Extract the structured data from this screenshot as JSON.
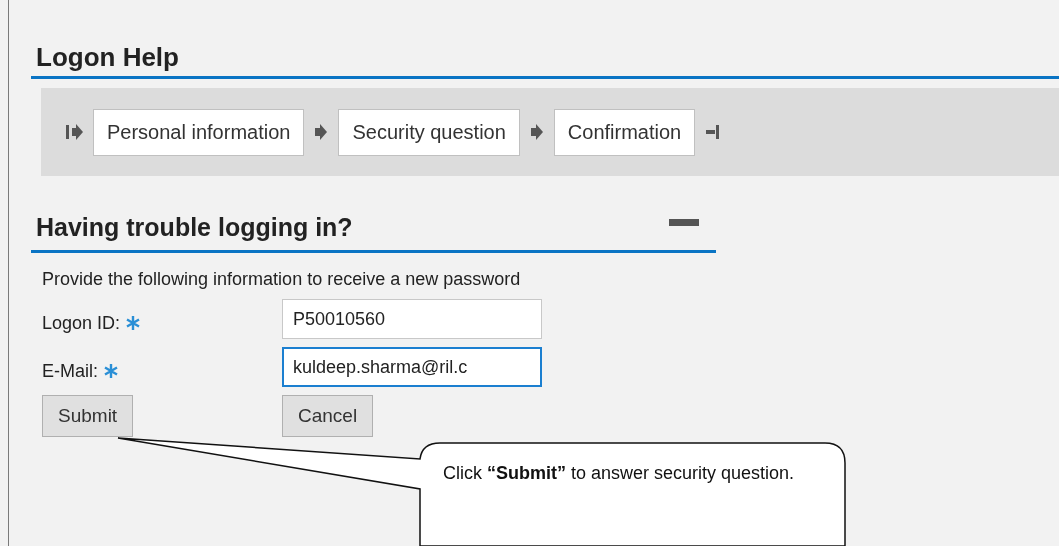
{
  "page_title": "Logon Help",
  "steps": [
    {
      "label": "Personal information"
    },
    {
      "label": "Security question"
    },
    {
      "label": "Confirmation"
    }
  ],
  "section": {
    "title": "Having trouble logging in?",
    "expanded": true,
    "instruction": "Provide the following information to receive a new password",
    "fields": [
      {
        "label": "Logon ID:",
        "required": true,
        "value": "P50010560",
        "focused": false
      },
      {
        "label": "E-Mail:",
        "required": true,
        "value": "kuldeep.sharma@ril.c",
        "focused": true
      }
    ],
    "buttons": [
      "Submit",
      "Cancel"
    ]
  },
  "callout": {
    "text": "Click **“Submit”** to answer security question."
  }
}
